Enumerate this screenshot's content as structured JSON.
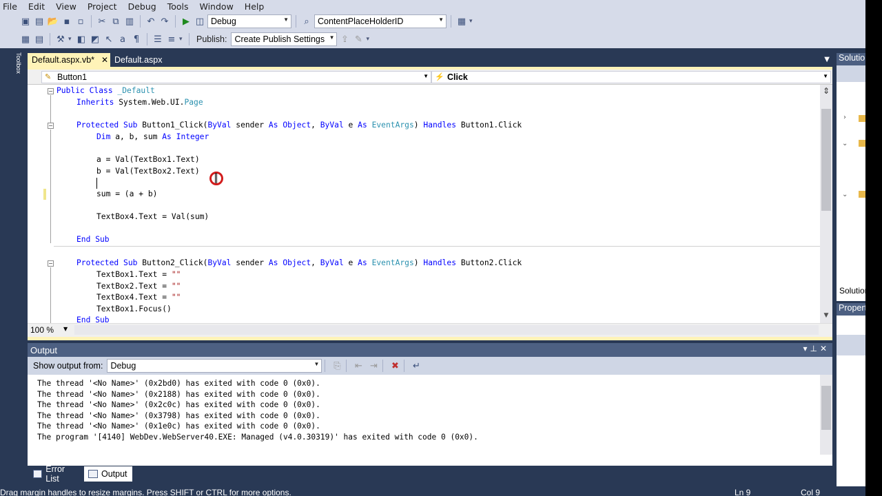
{
  "menu": [
    "File",
    "Edit",
    "View",
    "Project",
    "Debug",
    "Tools",
    "Window",
    "Help"
  ],
  "toolbar1": {
    "config_value": "Debug",
    "find_value": "ContentPlaceHolderID"
  },
  "toolbar2": {
    "publish_label": "Publish:",
    "publish_value": "Create Publish Settings"
  },
  "tabs": {
    "active": "Default.aspx.vb*",
    "inactive": "Default.aspx"
  },
  "navbar": {
    "object": "Button1",
    "event": "Click"
  },
  "code": {
    "l1": [
      "Public Class",
      " _Default"
    ],
    "l2": [
      "Inherits",
      " System.Web.UI.",
      "Page"
    ],
    "l3": [
      "Protected Sub",
      " Button1_Click(",
      "ByVal",
      " sender ",
      "As",
      " ",
      "Object",
      ", ",
      "ByVal",
      " e ",
      "As",
      " ",
      "EventArgs",
      ") ",
      "Handles",
      " Button1.Click"
    ],
    "l4": [
      "Dim",
      " a, b, sum ",
      "As",
      " ",
      "Integer"
    ],
    "l5": "a = Val(TextBox1.Text)",
    "l6": "b = Val(TextBox2.Text)",
    "l7": "sum = (a + b)",
    "l8": "TextBox4.Text = Val(sum)",
    "l9": "End Sub",
    "l10": [
      "Protected Sub",
      " Button2_Click(",
      "ByVal",
      " sender ",
      "As",
      " ",
      "Object",
      ", ",
      "ByVal",
      " e ",
      "As",
      " ",
      "EventArgs",
      ") ",
      "Handles",
      " Button2.Click"
    ],
    "l11": [
      "TextBox1.Text = ",
      "\"\""
    ],
    "l12": [
      "TextBox2.Text = ",
      "\"\""
    ],
    "l13": [
      "TextBox4.Text = ",
      "\"\""
    ],
    "l14": "TextBox1.Focus()",
    "l15": "End Sub"
  },
  "zoom": "100 %",
  "output": {
    "title": "Output",
    "show_from_label": "Show output from:",
    "show_from_value": "Debug",
    "lines": [
      "The thread '<No Name>' (0x2bd0) has exited with code 0 (0x0).",
      "The thread '<No Name>' (0x2188) has exited with code 0 (0x0).",
      "The thread '<No Name>' (0x2c0c) has exited with code 0 (0x0).",
      "The thread '<No Name>' (0x3798) has exited with code 0 (0x0).",
      "The thread '<No Name>' (0x1e0c) has exited with code 0 (0x0).",
      "The program '[4140] WebDev.WebServer40.EXE: Managed (v4.0.30319)' has exited with code 0 (0x0)."
    ]
  },
  "bottom_tabs": {
    "error_list": "Error List",
    "output": "Output"
  },
  "status": {
    "message": "Drag margin handles to resize margins. Press SHIFT or CTRL for more options.",
    "ln": "Ln 9",
    "col": "Col 9"
  },
  "right_panels": {
    "solution": "Solution Explorer",
    "solution_tab": "Solution Explorer",
    "properties": "Properties"
  },
  "left_panel": "Toolbox",
  "colors": {
    "ide_background": "#293955",
    "keyword": "#0000ff",
    "type": "#2b91af",
    "string": "#a31515",
    "active_tab": "#fff3b8"
  }
}
